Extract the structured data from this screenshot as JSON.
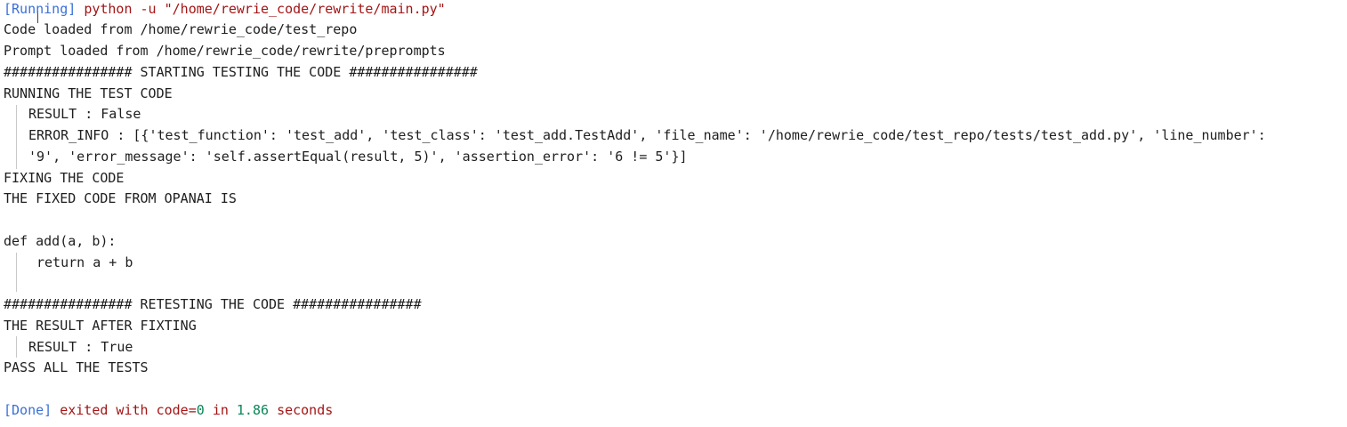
{
  "run": {
    "running_tag": "[Running]",
    "command": "python -u \"/home/rewrie_code/rewrite/main.py\""
  },
  "lines": {
    "code_loaded": "Code loaded from /home/rewrie_code/test_repo",
    "prompt_loaded": "Prompt loaded from /home/rewrie_code/rewrite/preprompts",
    "start_banner": "################ STARTING TESTING THE CODE ################",
    "running_test": "RUNNING THE TEST CODE",
    "result_false": "RESULT : False",
    "error_info_1": "ERROR_INFO : [{'test_function': 'test_add', 'test_class': 'test_add.TestAdd', 'file_name': '/home/rewrie_code/test_repo/tests/test_add.py', 'line_number':",
    "error_info_2": "'9', 'error_message': 'self.assertEqual(result, 5)', 'assertion_error': '6 != 5'}]",
    "fixing": "FIXING THE CODE",
    "fixed_from": "THE FIXED CODE FROM OPANAI IS",
    "def_line": "def add(a, b):",
    "return_line": "return a + b",
    "retest_banner": "################ RETESTING THE CODE ################",
    "result_after": "THE RESULT AFTER FIXTING",
    "result_true": "RESULT : True",
    "pass_all": "PASS ALL THE TESTS"
  },
  "done": {
    "done_tag": "[Done]",
    "exited_with": "exited with",
    "code_label": "code=",
    "code_value": "0",
    "in_label": "in",
    "seconds_value": "1.86",
    "seconds_label": "seconds"
  },
  "colors": {
    "tag_blue": "#3a6fd8",
    "text_red": "#a31515",
    "number_green": "#098658"
  }
}
